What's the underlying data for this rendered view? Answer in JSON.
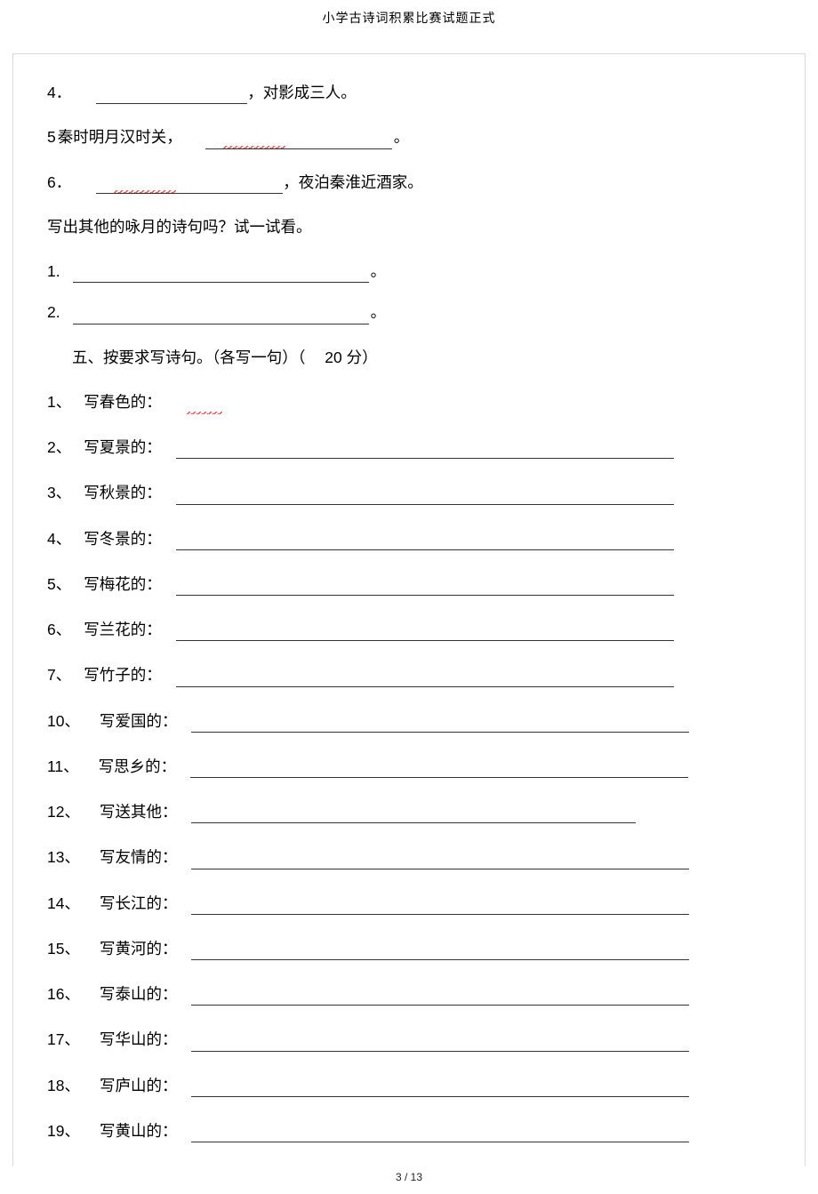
{
  "header_title": "小学古诗词积累比赛试题正式",
  "fill_lines": {
    "l4": {
      "num": "4．",
      "before": "",
      "after": "，对影成三人。"
    },
    "l5": {
      "num": "5",
      "before": "秦时明月汉时关，",
      "after": "。"
    },
    "l6": {
      "num": "6．",
      "before": "",
      "after": "，夜泊秦淮近酒家。"
    }
  },
  "prompt_other": "写出其他的咏月的诗句吗？试一试看。",
  "extra": {
    "e1": {
      "num": "1.",
      "tail": "。"
    },
    "e2": {
      "num": "2.",
      "tail": "。"
    }
  },
  "section5": {
    "title_pre": "五、按要求写诗句。（各写一句）（",
    "points_num": "20",
    "points_suffix": "分）"
  },
  "items": [
    {
      "no": "1、",
      "label": "写春色的："
    },
    {
      "no": "2、",
      "label": "写夏景的："
    },
    {
      "no": "3、",
      "label": "写秋景的："
    },
    {
      "no": "4、",
      "label": "写冬景的："
    },
    {
      "no": "5、",
      "label": "写梅花的："
    },
    {
      "no": "6、",
      "label": "写兰花的："
    },
    {
      "no": "7、",
      "label": "写竹子的："
    },
    {
      "no": "10、",
      "label": "写爱国的："
    },
    {
      "no": "11、",
      "label": "写思乡的："
    },
    {
      "no": "12、",
      "label": "写送其他："
    },
    {
      "no": "13、",
      "label": "写友情的："
    },
    {
      "no": "14、",
      "label": "写长江的："
    },
    {
      "no": "15、",
      "label": "写黄河的："
    },
    {
      "no": "16、",
      "label": "写泰山的："
    },
    {
      "no": "17、",
      "label": "写华山的："
    },
    {
      "no": "18、",
      "label": "写庐山的："
    },
    {
      "no": "19、",
      "label": "写黄山的："
    }
  ],
  "footer": {
    "page": "3",
    "sep": " / ",
    "total": "13"
  }
}
